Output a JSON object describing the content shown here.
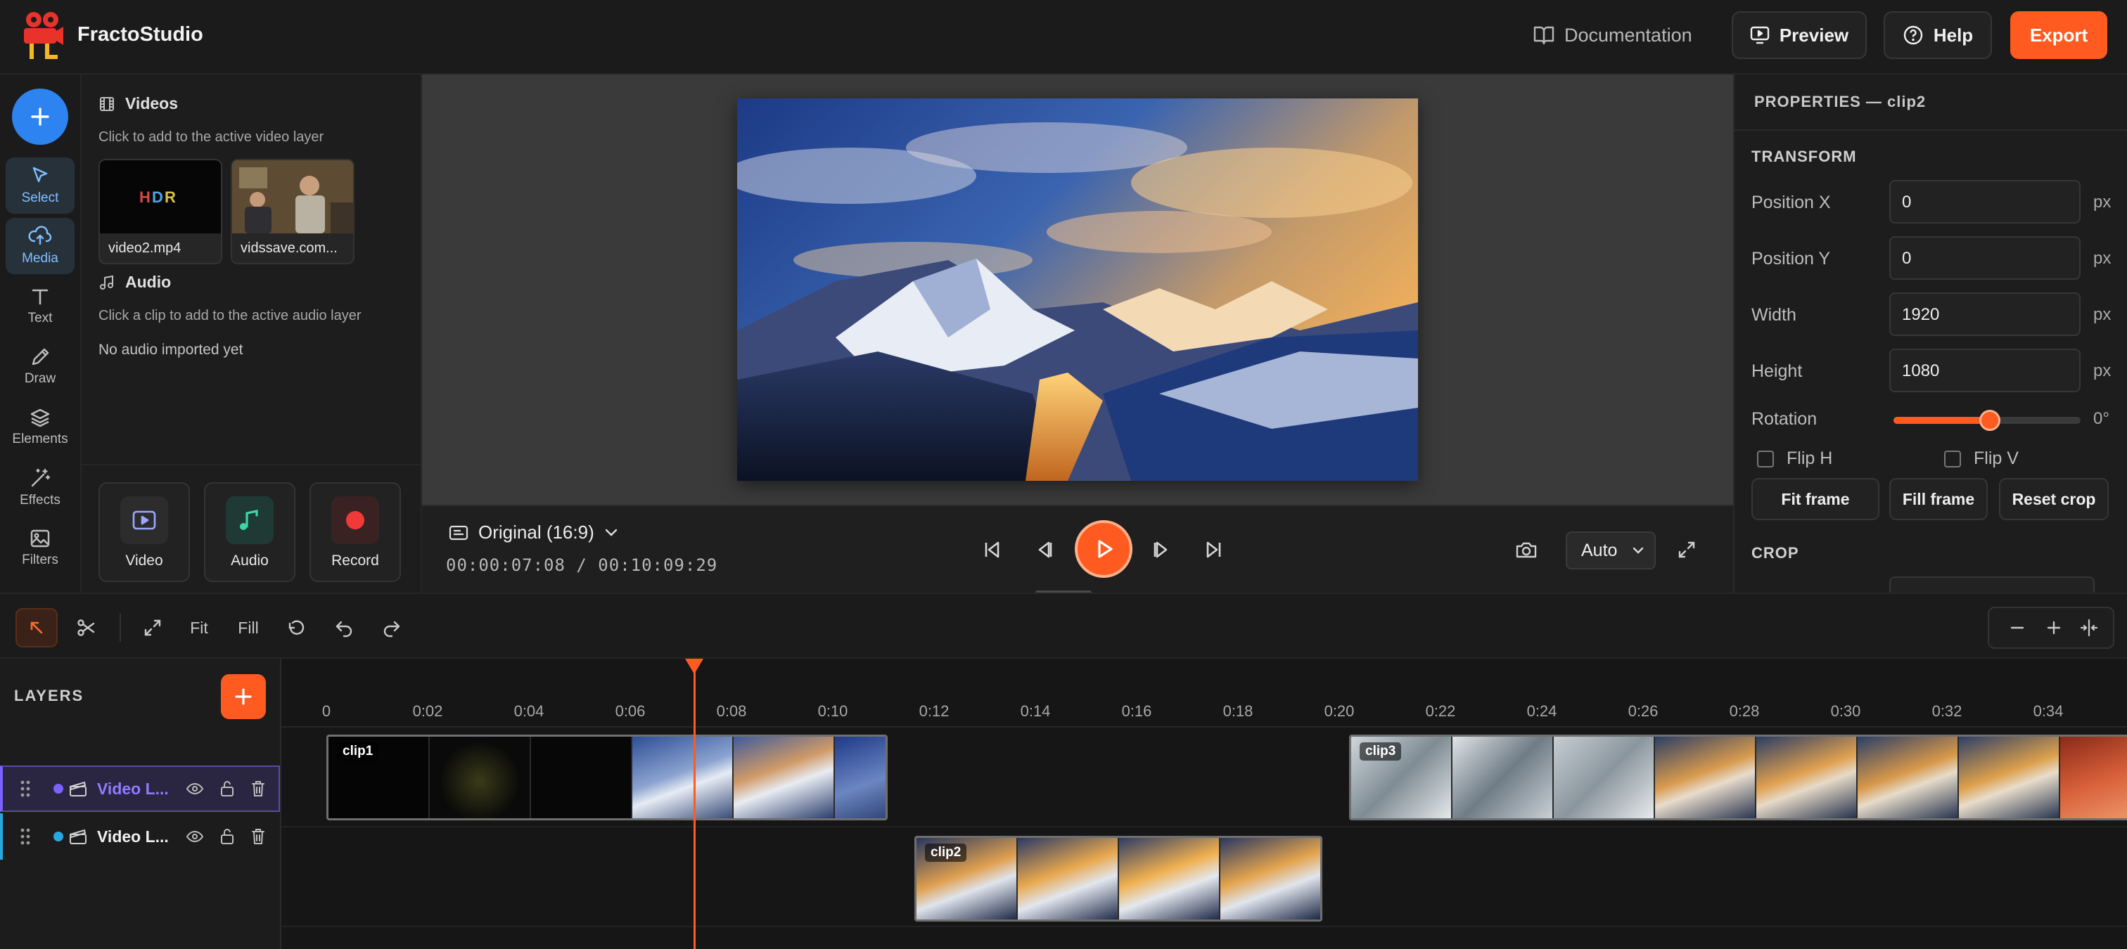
{
  "header": {
    "brand": "FractoStudio",
    "documentation": "Documentation",
    "preview": "Preview",
    "help": "Help",
    "export": "Export",
    "accent": "#ff5a1f"
  },
  "rail": {
    "tools": [
      {
        "label": "Select",
        "icon": "cursor-icon"
      },
      {
        "label": "Media",
        "icon": "cloud-upload-icon"
      },
      {
        "label": "Text",
        "icon": "text-icon"
      },
      {
        "label": "Draw",
        "icon": "pencil-icon"
      },
      {
        "label": "Elements",
        "icon": "layers-icon"
      },
      {
        "label": "Effects",
        "icon": "magic-wand-icon"
      },
      {
        "label": "Filters",
        "icon": "image-icon"
      }
    ]
  },
  "media": {
    "videos_title": "Videos",
    "videos_hint": "Click to add to the active video layer",
    "videos": [
      {
        "name": "video2.mp4"
      },
      {
        "name": "vidssave.com..."
      }
    ],
    "audio_title": "Audio",
    "audio_hint": "Click a clip to add to the active audio layer",
    "audio_empty": "No audio imported yet",
    "import": {
      "video": "Video",
      "audio": "Audio",
      "record": "Record"
    }
  },
  "player": {
    "aspect": "Original (16:9)",
    "timecode": "00:00:07:08 / 00:10:09:29",
    "quality": "Auto"
  },
  "properties": {
    "title": "PROPERTIES — clip2",
    "transform": "TRANSFORM",
    "pos_x_label": "Position X",
    "pos_x": "0",
    "pos_y_label": "Position Y",
    "pos_y": "0",
    "width_label": "Width",
    "width": "1920",
    "height_label": "Height",
    "height": "1080",
    "unit": "px",
    "rotation_label": "Rotation",
    "rotation": "0°",
    "flip_h": "Flip H",
    "flip_v": "Flip V",
    "fit_frame": "Fit frame",
    "fill_frame": "Fill frame",
    "reset_crop": "Reset crop",
    "crop": "CROP"
  },
  "toolbar": {
    "fit": "Fit",
    "fill": "Fill"
  },
  "layers": {
    "title": "LAYERS",
    "items": [
      {
        "name": "Video L...",
        "color": "#7b61ff",
        "selected": true
      },
      {
        "name": "Video L...",
        "color": "#29a8e0",
        "selected": false
      }
    ]
  },
  "timeline": {
    "ticks": [
      "0",
      "0:02",
      "0:04",
      "0:06",
      "0:08",
      "0:10",
      "0:12",
      "0:14",
      "0:16",
      "0:18",
      "0:20",
      "0:22",
      "0:24",
      "0:26",
      "0:28",
      "0:30",
      "0:32",
      "0:34"
    ],
    "clips": [
      {
        "label": "clip1",
        "track": 1
      },
      {
        "label": "clip2",
        "track": 2
      },
      {
        "label": "clip3",
        "track": 1
      }
    ],
    "playhead_seconds": 7.27
  }
}
